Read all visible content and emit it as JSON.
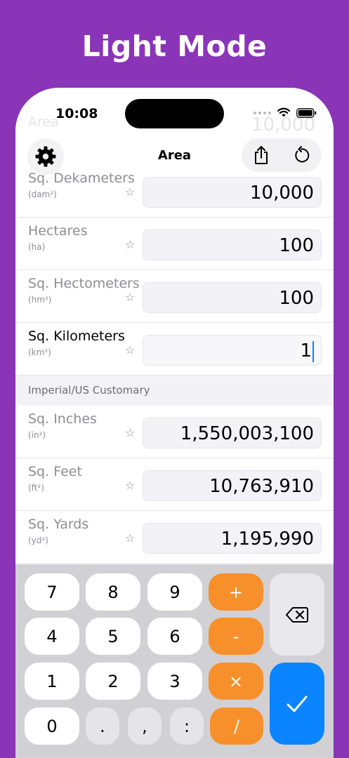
{
  "promo": {
    "title": "Light Mode"
  },
  "status_bar": {
    "time": "10:08"
  },
  "nav": {
    "title": "Area"
  },
  "ghost_row": {
    "label": "Area",
    "value": "10,000"
  },
  "metric_units": [
    {
      "name": "Sq. Dekameters",
      "symbol": "(dam²)",
      "value": "10,000",
      "active": false
    },
    {
      "name": "Hectares",
      "symbol": "(ha)",
      "value": "100",
      "active": false
    },
    {
      "name": "Sq. Hectometers",
      "symbol": "(hm²)",
      "value": "100",
      "active": false
    },
    {
      "name": "Sq. Kilometers",
      "symbol": "(km²)",
      "value": "1",
      "active": true
    }
  ],
  "section_imperial": {
    "title": "Imperial/US Customary"
  },
  "imperial_units": [
    {
      "name": "Sq. Inches",
      "symbol": "(in²)",
      "value": "1,550,003,100"
    },
    {
      "name": "Sq. Feet",
      "symbol": "(ft²)",
      "value": "10,763,910"
    },
    {
      "name": "Sq. Yards",
      "symbol": "(yd²)",
      "value": "1,195,990"
    }
  ],
  "keypad": {
    "row1": [
      "7",
      "8",
      "9",
      "+"
    ],
    "row2": [
      "4",
      "5",
      "6",
      "-"
    ],
    "row3": [
      "1",
      "2",
      "3",
      "×"
    ],
    "row4": [
      "0",
      ".",
      ",",
      ":",
      "/"
    ]
  },
  "colors": {
    "background": "#8a35b8",
    "operator": "#f7902b",
    "accent": "#0a84ff"
  },
  "icons": [
    "gear-icon",
    "share-icon",
    "reset-icon",
    "star-icon",
    "delete-backspace-icon",
    "checkmark-icon"
  ]
}
